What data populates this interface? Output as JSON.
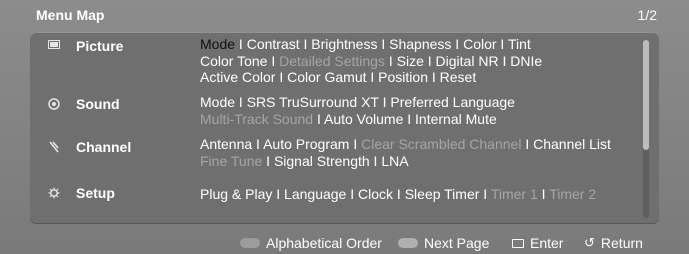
{
  "header": {
    "title": "Menu Map",
    "page_indicator": "1/2"
  },
  "separator": " I ",
  "rows": [
    {
      "icon": "picture-icon",
      "label": "Picture",
      "lines": [
        [
          {
            "text": "Mode",
            "state": "selected"
          },
          {
            "text": "Contrast",
            "state": "normal"
          },
          {
            "text": "Brightness",
            "state": "normal"
          },
          {
            "text": "Shapness",
            "state": "normal"
          },
          {
            "text": "Color",
            "state": "normal"
          },
          {
            "text": "Tint",
            "state": "normal"
          }
        ],
        [
          {
            "text": "Color Tone",
            "state": "normal"
          },
          {
            "text": "Detailed Settings",
            "state": "disabled"
          },
          {
            "text": "Size",
            "state": "normal"
          },
          {
            "text": "Digital NR",
            "state": "normal"
          },
          {
            "text": "DNIe",
            "state": "normal"
          }
        ],
        [
          {
            "text": "Active Color",
            "state": "normal"
          },
          {
            "text": "Color Gamut",
            "state": "normal"
          },
          {
            "text": "Position",
            "state": "normal"
          },
          {
            "text": "Reset",
            "state": "normal"
          }
        ]
      ]
    },
    {
      "icon": "sound-icon",
      "label": "Sound",
      "lines": [
        [
          {
            "text": "Mode",
            "state": "normal"
          },
          {
            "text": "SRS TruSurround XT",
            "state": "normal"
          },
          {
            "text": "Preferred Language",
            "state": "normal"
          }
        ],
        [
          {
            "text": "Multi-Track Sound",
            "state": "disabled"
          },
          {
            "text": "Auto Volume",
            "state": "normal"
          },
          {
            "text": "Internal Mute",
            "state": "normal"
          }
        ]
      ]
    },
    {
      "icon": "channel-icon",
      "label": "Channel",
      "lines": [
        [
          {
            "text": "Antenna",
            "state": "normal"
          },
          {
            "text": "Auto Program",
            "state": "normal"
          },
          {
            "text": "Clear Scrambled Channel",
            "state": "disabled"
          },
          {
            "text": "Channel List",
            "state": "normal"
          }
        ],
        [
          {
            "text": "Fine Tune",
            "state": "disabled"
          },
          {
            "text": "Signal Strength",
            "state": "normal"
          },
          {
            "text": "LNA",
            "state": "normal"
          }
        ]
      ]
    },
    {
      "icon": "setup-icon",
      "label": "Setup",
      "lines": [
        [
          {
            "text": "Plug & Play",
            "state": "normal"
          },
          {
            "text": "Language",
            "state": "normal"
          },
          {
            "text": "Clock",
            "state": "normal"
          },
          {
            "text": "Sleep Timer",
            "state": "normal"
          },
          {
            "text": "Timer 1",
            "state": "disabled"
          },
          {
            "text": "Timer 2",
            "state": "disabled"
          }
        ]
      ]
    }
  ],
  "footer": {
    "alphabetical_order": "Alphabetical Order",
    "next_page": "Next Page",
    "enter": "Enter",
    "return": "Return"
  },
  "colors": {
    "background": "#7f7f7f",
    "panel": "#6f6f6f",
    "text": "#ffffff",
    "disabled_text": "#a5a5a5",
    "selected_text": "#111111"
  }
}
